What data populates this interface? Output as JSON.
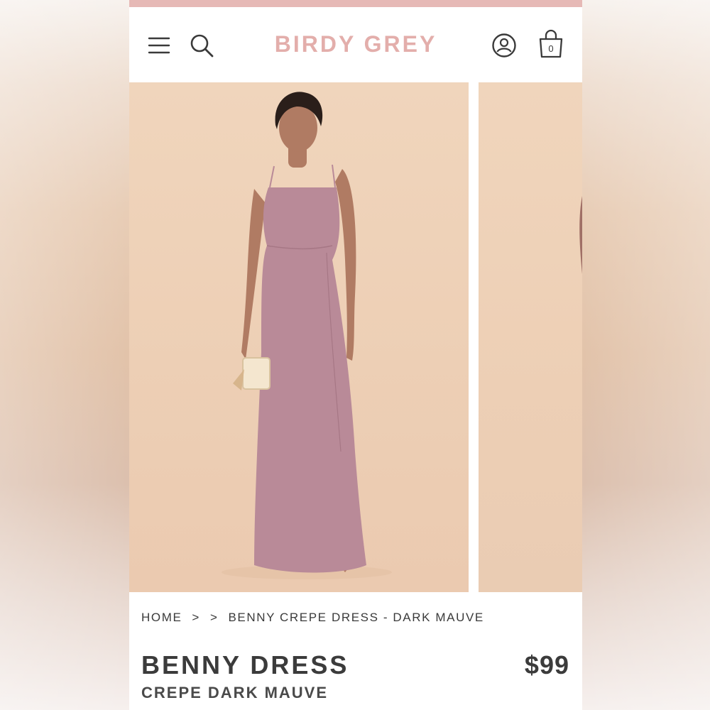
{
  "header": {
    "brand": "BIRDY GREY",
    "cart_count": "0",
    "accent_color": "#e3aeab"
  },
  "gallery": {
    "images": [
      "dress-front-photo",
      "dress-next-photo"
    ]
  },
  "breadcrumb": {
    "home": "HOME",
    "sep1": ">",
    "sep2": ">",
    "current": "BENNY CREPE DRESS - DARK MAUVE"
  },
  "product": {
    "name": "BENNY DRESS",
    "variant": "CREPE DARK MAUVE",
    "price": "$99",
    "dress_color": "#b98a98"
  }
}
